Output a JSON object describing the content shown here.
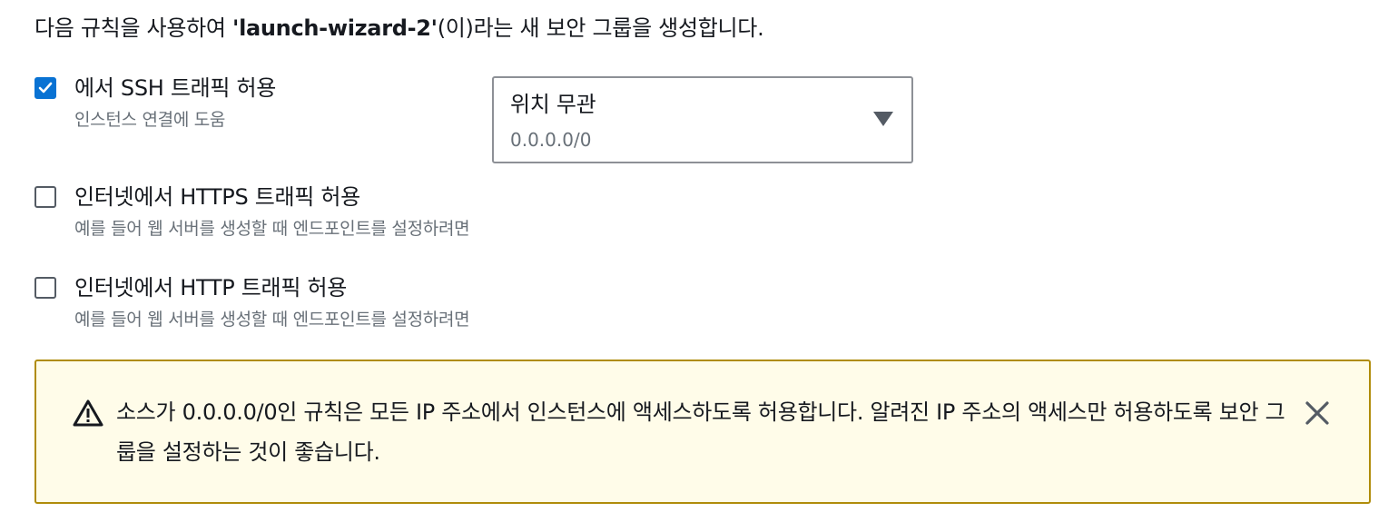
{
  "intro": {
    "prefix": "다음 규칙을 사용하여 ",
    "group_name": "'launch-wizard-2'",
    "suffix": "(이)라는 새 보안 그룹을 생성합니다."
  },
  "rules": [
    {
      "label": "에서 SSH 트래픽 허용",
      "description": "인스턴스 연결에 도움",
      "checked": true
    },
    {
      "label": "인터넷에서 HTTPS 트래픽 허용",
      "description": "예를 들어 웹 서버를 생성할 때 엔드포인트를 설정하려면",
      "checked": false
    },
    {
      "label": "인터넷에서 HTTP 트래픽 허용",
      "description": "예를 들어 웹 서버를 생성할 때 엔드포인트를 설정하려면",
      "checked": false
    }
  ],
  "ssh_source_select": {
    "label": "위치 무관",
    "value": "0.0.0.0/0",
    "icon": "caret-down-icon"
  },
  "warning": {
    "message": "소스가 0.0.0.0/0인 규칙은 모든 IP 주소에서 인스턴스에 액세스하도록 허용합니다. 알려진 IP 주소의 액세스만 허용하도록 보안 그룹을 설정하는 것이 좋습니다.",
    "icon": "warning-icon",
    "close_icon": "close-icon"
  },
  "colors": {
    "checkbox_checked": "#0972d3",
    "alert_background": "#fffce9",
    "alert_border": "#b08c0a",
    "secondary_text": "#687078"
  }
}
